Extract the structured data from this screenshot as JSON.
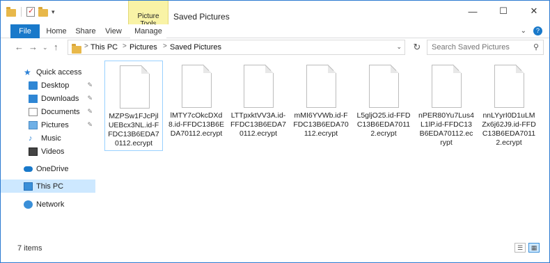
{
  "window": {
    "title": "Saved Pictures",
    "context_tab": "Picture Tools",
    "controls": {
      "minimize": "—",
      "maximize": "☐",
      "close": "✕"
    }
  },
  "ribbon": {
    "tabs": [
      "File",
      "Home",
      "Share",
      "View",
      "Manage"
    ],
    "collapse": "⌄",
    "help": "?"
  },
  "address": {
    "back": "←",
    "forward": "→",
    "recent": "⌄",
    "up": "↑",
    "crumbs": [
      "This PC",
      "Pictures",
      "Saved Pictures"
    ],
    "separator": ">",
    "refresh": "↻",
    "search_placeholder": "Search Saved Pictures"
  },
  "nav": {
    "quick_access": "Quick access",
    "items": [
      "Desktop",
      "Downloads",
      "Documents",
      "Pictures",
      "Music",
      "Videos"
    ],
    "onedrive": "OneDrive",
    "this_pc": "This PC",
    "network": "Network",
    "pin": "📌"
  },
  "files": [
    "MZPSw1FJcPjlUEBcx3NL.id-FFDC13B6EDA70112.ecrypt",
    "lMTY7cOkcDXd8.id-FFDC13B6EDA70112.ecrypt",
    "LTTpxktVV3A.id-FFDC13B6EDA70112.ecrypt",
    "mMI6YVWb.id-FFDC13B6EDA70112.ecrypt",
    "L5gljO25.id-FFDC13B6EDA70112.ecrypt",
    "nPER80Yu7Lus4L1lP.id-FFDC13B6EDA70112.ecrypt",
    "nnLYyrI0D1uLMZx6j62J9.id-FFDC13B6EDA70112.ecrypt"
  ],
  "status": {
    "count": "7 items"
  },
  "colors": {
    "accent": "#1979ca",
    "context_tab": "#f9f3a6",
    "selected": "#cde8ff"
  }
}
